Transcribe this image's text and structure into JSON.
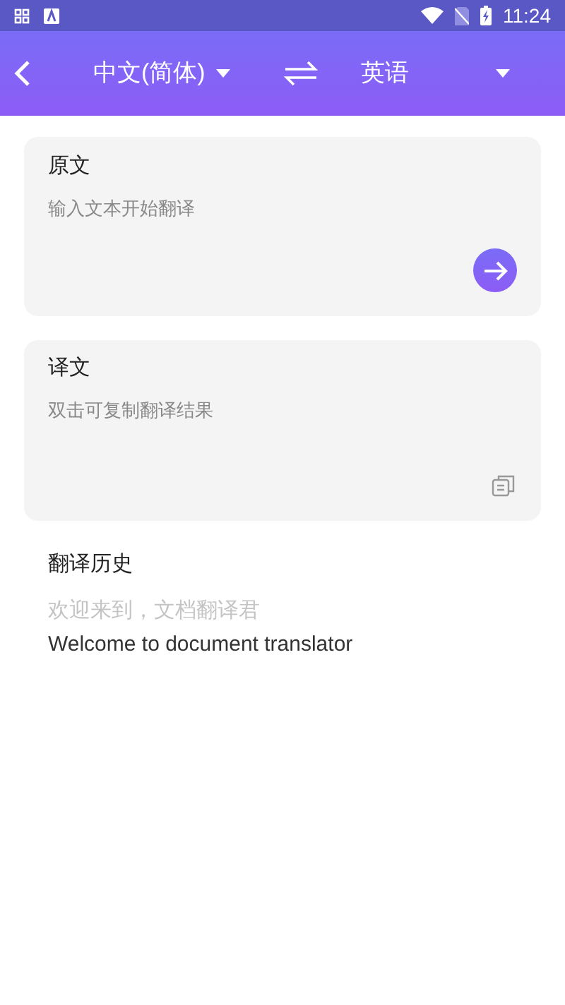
{
  "status_bar": {
    "time": "11:24"
  },
  "header": {
    "source_language": "中文(简体)",
    "target_language": "英语"
  },
  "source_card": {
    "title": "原文",
    "placeholder": "输入文本开始翻译"
  },
  "result_card": {
    "title": "译文",
    "placeholder": "双击可复制翻译结果"
  },
  "history": {
    "title": "翻译历史",
    "items": [
      {
        "kind": "hint",
        "text": "欢迎来到，文档翻译君"
      },
      {
        "kind": "entry",
        "text": "Welcome to document translator"
      }
    ]
  }
}
